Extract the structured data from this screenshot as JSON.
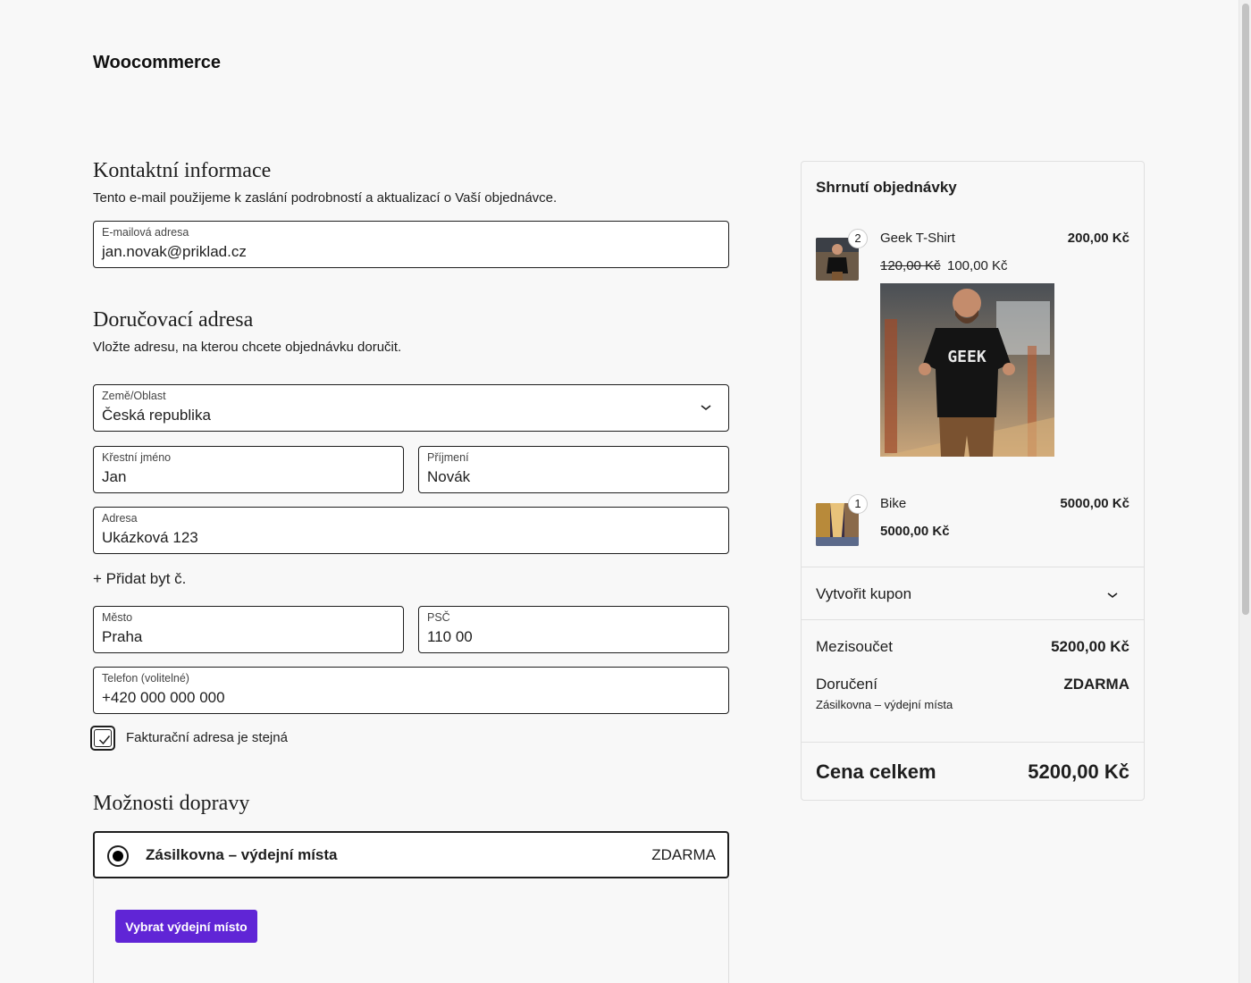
{
  "site": {
    "title": "Woocommerce"
  },
  "contact": {
    "heading": "Kontaktní informace",
    "description": "Tento e-mail použijeme k zaslání podrobností a aktualizací o Vaší objednávce.",
    "email_label": "E-mailová adresa",
    "email_value": "jan.novak@priklad.cz"
  },
  "shipping_address": {
    "heading": "Doručovací adresa",
    "description": "Vložte adresu, na kterou chcete objednávku doručit.",
    "country_label": "Země/Oblast",
    "country_value": "Česká republika",
    "first_name_label": "Křestní jméno",
    "first_name_value": "Jan",
    "last_name_label": "Příjmení",
    "last_name_value": "Novák",
    "address_label": "Adresa",
    "address_value": "Ukázková 123",
    "add_apartment": "+ Přidat byt č.",
    "city_label": "Město",
    "city_value": "Praha",
    "zip_label": "PSČ",
    "zip_value": "110 00",
    "phone_label": "Telefon (volitelné)",
    "phone_value": "+420 000 000 000",
    "billing_same_label": "Fakturační adresa je stejná",
    "billing_same_checked": true
  },
  "shipping_options": {
    "heading": "Možnosti dopravy",
    "option_name": "Zásilkovna – výdejní místa",
    "option_price": "ZDARMA",
    "pickup_button": "Vybrat výdejní místo",
    "button_color": "#6025d6"
  },
  "summary": {
    "title": "Shrnutí objednávky",
    "items": [
      {
        "name": "Geek T-Shirt",
        "qty": "2",
        "total": "200,00 Kč",
        "regular_price": "120,00 Kč",
        "sale_price": "100,00 Kč",
        "image_text": "GEEK"
      },
      {
        "name": "Bike",
        "qty": "1",
        "total": "5000,00 Kč",
        "price": "5000,00 Kč"
      }
    ],
    "coupon_label": "Vytvořit kupon",
    "subtotal_label": "Mezisoučet",
    "subtotal_value": "5200,00 Kč",
    "delivery_label": "Doručení",
    "delivery_value": "ZDARMA",
    "delivery_method": "Zásilkovna – výdejní místa",
    "total_label": "Cena celkem",
    "total_value": "5200,00 Kč"
  }
}
